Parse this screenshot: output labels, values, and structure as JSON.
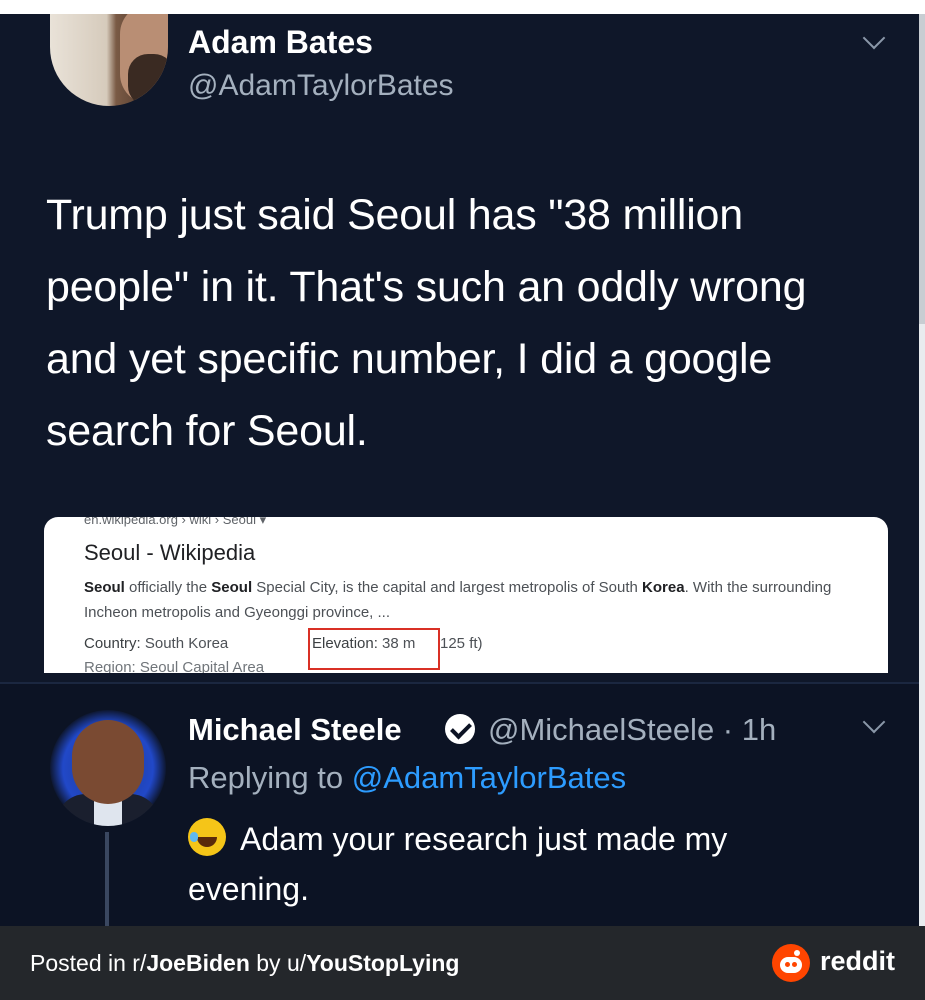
{
  "tweet1": {
    "name": "Adam Bates",
    "handle": "@AdamTaylorBates",
    "text": "Trump just said Seoul has \"38 million people\" in it. That's such an oddly wrong and yet specific number, I did a google search for Seoul."
  },
  "search_card": {
    "url": "en.wikipedia.org › wiki › Seoul ▾",
    "title": "Seoul - Wikipedia",
    "snippet_parts": {
      "p1": "Seoul",
      "p2": " officially the ",
      "p3": "Seoul",
      "p4": " Special City, is the capital and largest metropolis of South ",
      "p5": "Korea",
      "p6": ". With the surrounding Incheon metropolis and Gyeonggi province, ..."
    },
    "country_label": "Country:",
    "country_value": " South Korea",
    "elevation_label": "Elevation:",
    "elevation_value": " 38 m",
    "elevation_rest": "125 ft)",
    "region_partial": "Region: Seoul Capital Area"
  },
  "tweet2": {
    "name": "Michael Steele",
    "handle_time": "@MichaelSteele · 1h",
    "replying_prefix": "Replying to ",
    "replying_mention": "@AdamTaylorBates",
    "text": "Adam your research just made my evening."
  },
  "footer": {
    "posted_prefix": "Posted in r/",
    "subreddit": "JoeBiden",
    "by_prefix": " by u/",
    "user": "YouStopLying",
    "brand": "reddit",
    "brand_color": "#ff4500"
  }
}
